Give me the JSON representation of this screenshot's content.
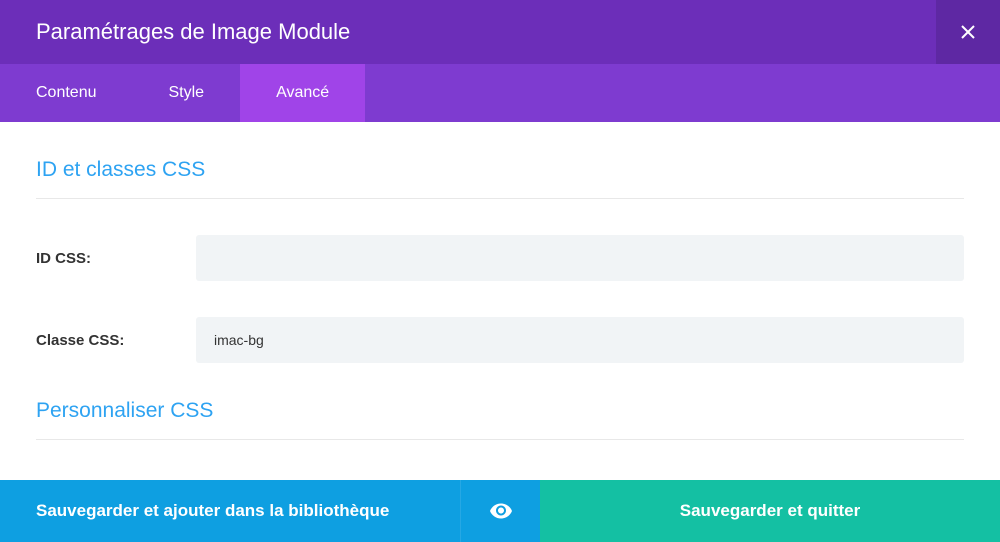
{
  "header": {
    "title": "Paramétrages de Image Module"
  },
  "tabs": {
    "content": "Contenu",
    "style": "Style",
    "advanced": "Avancé"
  },
  "sections": {
    "css_id_classes": {
      "title": "ID et classes CSS",
      "fields": {
        "css_id": {
          "label": "ID CSS:",
          "value": ""
        },
        "css_class": {
          "label": "Classe CSS:",
          "value": "imac-bg"
        }
      }
    },
    "custom_css": {
      "title": "Personnaliser CSS"
    }
  },
  "footer": {
    "save_library": "Sauvegarder et ajouter dans la bibliothèque",
    "save_exit": "Sauvegarder et quitter"
  }
}
